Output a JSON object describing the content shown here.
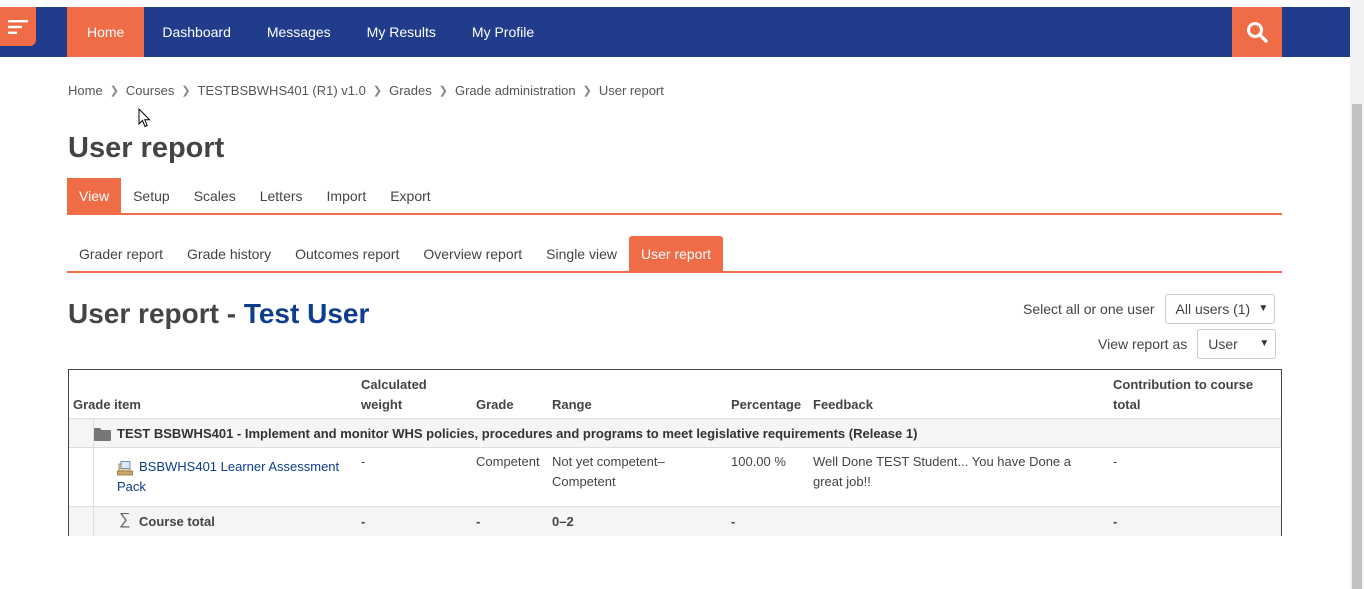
{
  "nav": {
    "items": [
      "Home",
      "Dashboard",
      "Messages",
      "My Results",
      "My Profile"
    ],
    "active_index": 0
  },
  "breadcrumb": [
    "Home",
    "Courses",
    "TESTBSBWHS401 (R1) v1.0",
    "Grades",
    "Grade administration",
    "User report"
  ],
  "page_title": "User report",
  "tabs_primary": [
    "View",
    "Setup",
    "Scales",
    "Letters",
    "Import",
    "Export"
  ],
  "tabs_secondary": [
    "Grader report",
    "Grade history",
    "Outcomes report",
    "Overview report",
    "Single view",
    "User report"
  ],
  "report": {
    "title_prefix": "User report - ",
    "user_name": "Test User",
    "select_user_label": "Select all or one user",
    "select_user_value": "All users (1)",
    "view_as_label": "View report as",
    "view_as_value": "User"
  },
  "table": {
    "headers": {
      "grade_item": "Grade item",
      "weight_1": "Calculated",
      "weight_2": "weight",
      "grade": "Grade",
      "range": "Range",
      "percentage": "Percentage",
      "feedback": "Feedback",
      "contribution_1": "Contribution to course",
      "contribution_2": "total"
    },
    "category": "TEST BSBWHS401 - Implement and monitor WHS policies, procedures and programs to meet legislative requirements (Release 1)",
    "item": {
      "name_1": "BSBWHS401 Learner Assessment",
      "name_2": "Pack",
      "weight": "-",
      "grade": "Competent",
      "range_1": "Not yet competent–",
      "range_2": "Competent",
      "percentage": "100.00 %",
      "feedback_1": "Well Done TEST Student... You have Done a",
      "feedback_2": "great job!!",
      "contribution": "-"
    },
    "total": {
      "label": "Course total",
      "weight": "-",
      "grade": "-",
      "range": "0–2",
      "percentage": "-",
      "contribution": "-"
    }
  }
}
